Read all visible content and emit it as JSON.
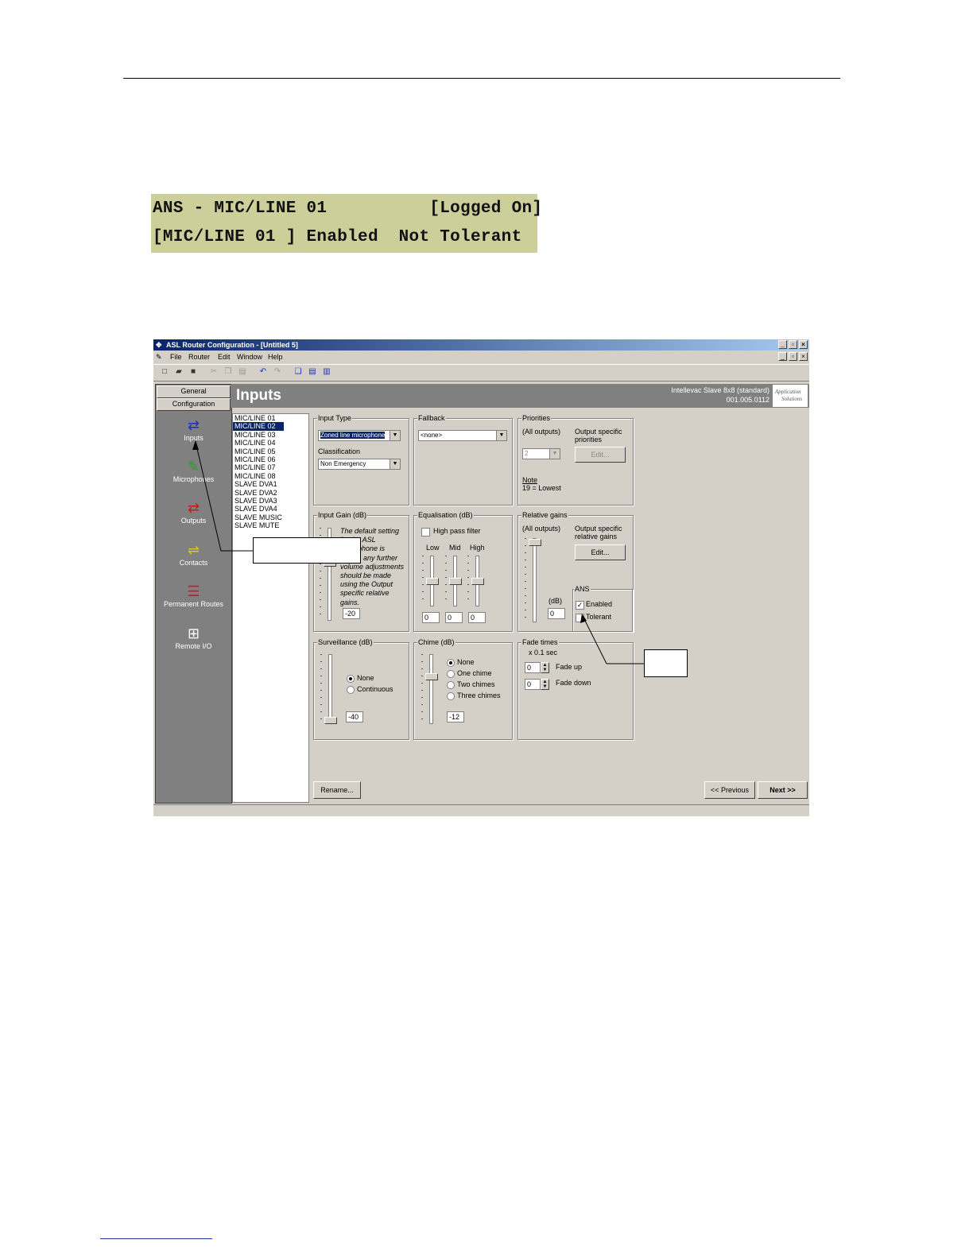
{
  "lcd": {
    "line1": "ANS - MIC/LINE 01          [Logged On]",
    "line2": "[MIC/LINE 01 ] Enabled  Not Tolerant"
  },
  "window": {
    "title": "ASL Router Configuration - [Untitled 5]",
    "menu": [
      "File",
      "Router",
      "Edit",
      "Window",
      "Help"
    ]
  },
  "sidebar": {
    "tabs": [
      "General",
      "Configuration"
    ],
    "items": [
      {
        "label": "Inputs",
        "icon": "inputs-arrows-icon",
        "color": "#1c2fbf"
      },
      {
        "label": "Microphones",
        "icon": "microphone-icon",
        "color": "#2a9a2a"
      },
      {
        "label": "Outputs",
        "icon": "outputs-arrows-icon",
        "color": "#cc1a1a"
      },
      {
        "label": "Contacts",
        "icon": "contacts-icon",
        "color": "#d8c820"
      },
      {
        "label": "Permanent Routes",
        "icon": "permanent-routes-icon",
        "color": "#c0203a"
      },
      {
        "label": "Remote I/O",
        "icon": "remote-io-icon",
        "color": "#ffffff"
      }
    ]
  },
  "header": {
    "title": "Inputs",
    "device_line1": "Intellevac Slave 8x8 (standard)",
    "device_line2": "001.005.0112",
    "logo_line1": "Application",
    "logo_line2": "Solutions"
  },
  "input_list": {
    "items": [
      "MIC/LINE 01",
      "MIC/LINE 02",
      "MIC/LINE 03",
      "MIC/LINE 04",
      "MIC/LINE 05",
      "MIC/LINE 06",
      "MIC/LINE 07",
      "MIC/LINE 08",
      "SLAVE DVA1",
      "SLAVE DVA2",
      "SLAVE DVA3",
      "SLAVE DVA4",
      "SLAVE MUSIC",
      "SLAVE MUTE"
    ],
    "selected_index": 1
  },
  "input_type": {
    "label": "Input Type",
    "value": "Zoned line microphone",
    "classification_label": "Classification",
    "classification_value": "Non Emergency"
  },
  "fallback": {
    "label": "Fallback",
    "value": "<none>"
  },
  "priorities": {
    "label": "Priorities",
    "all_outputs": "(All outputs)",
    "value": "2",
    "output_specific": "Output specific priorities",
    "edit": "Edit...",
    "note_title": "Note",
    "note_text": "19 = Lowest"
  },
  "input_gain": {
    "label": "Input Gain (dB)",
    "note": "The default setting for the ASL microphone is -14dB, any further volume adjustments should be made using the Output specific relative gains.",
    "value": "-20"
  },
  "equalisation": {
    "label": "Equalisation (dB)",
    "high_pass": "High pass filter",
    "low": "Low",
    "mid": "Mid",
    "high": "High",
    "low_value": "0",
    "mid_value": "0",
    "high_value": "0"
  },
  "relative_gains": {
    "label": "Relative gains",
    "all_outputs": "(All outputs)",
    "output_specific": "Output specific relative gains",
    "edit": "Edit...",
    "db": "(dB)",
    "value": "0"
  },
  "ans": {
    "label": "ANS",
    "enabled": "Enabled",
    "tolerant": "Tolerant",
    "enabled_checked": true
  },
  "surveillance": {
    "label": "Surveillance (dB)",
    "none": "None",
    "continuous": "Continuous",
    "value": "-40"
  },
  "chime": {
    "label": "Chime (dB)",
    "options": [
      "None",
      "One chime",
      "Two chimes",
      "Three chimes"
    ],
    "value": "-12"
  },
  "fade": {
    "label": "Fade times",
    "unit": "x 0.1 sec",
    "up_label": "Fade up",
    "down_label": "Fade down",
    "up_value": "0",
    "down_value": "0"
  },
  "buttons": {
    "rename": "Rename...",
    "previous": "<< Previous",
    "next": "Next >>"
  }
}
